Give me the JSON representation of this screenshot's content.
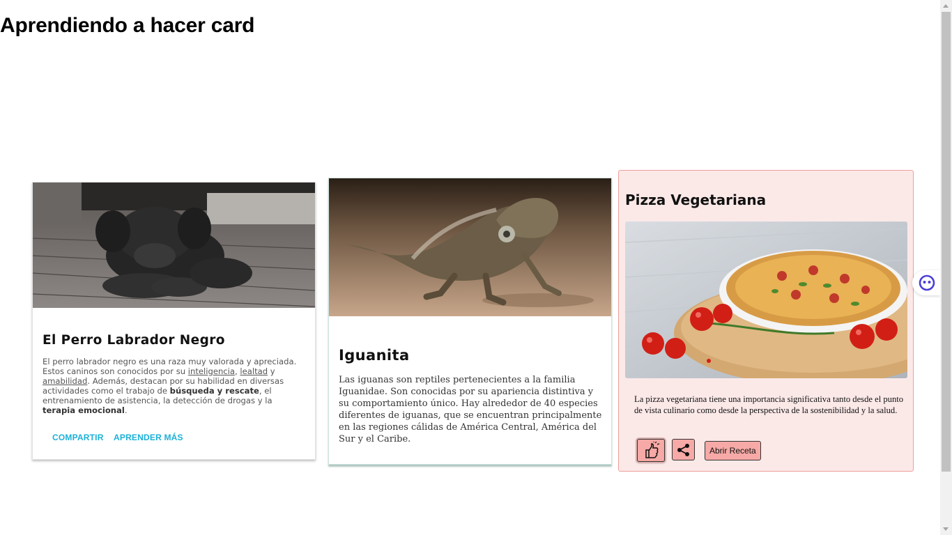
{
  "page": {
    "title": "Aprendiendo a hacer card"
  },
  "cards": {
    "dog": {
      "title": "El Perro Labrador Negro",
      "desc": {
        "p1": "El perro labrador negro es una raza muy valorada y apreciada. Estos caninos son conocidos por su ",
        "l1": "inteligencia",
        "s1": ", ",
        "l2": "lealtad",
        "s2": " y ",
        "l3": "amabilidad",
        "p2": ". Además, destacan por su habilidad en diversas actividades como el trabajo de ",
        "b1": "búsqueda y rescate",
        "p3": ", el entrenamiento de asistencia, la detección de drogas y la ",
        "b2": "terapia emocional",
        "p4": "."
      },
      "share_label": "COMPARTIR",
      "learn_label": "APRENDER MÁS"
    },
    "iguana": {
      "title": "Iguanita",
      "desc": "Las iguanas son reptiles pertenecientes a la familia Iguanidae. Son conocidas por su apariencia distintiva y su comportamiento único. Hay alrededor de 40 especies diferentes de iguanas, que se encuentran principalmente en las regiones cálidas de América Central, América del Sur y el Caribe."
    },
    "pizza": {
      "title": "Pizza Vegetariana",
      "desc": "La pizza vegetariana tiene una importancia significativa tanto desde el punto de vista culinario como desde la perspectiva de la sostenibilidad y la salud.",
      "like_icon": "thumbs-up-icon",
      "share_icon": "share-icon",
      "recipe_label": "Abrir Receta"
    }
  },
  "colors": {
    "link": "#1bb1d8",
    "pizza_card_bg": "#fbe9e8",
    "pizza_card_border": "#ec9f9c",
    "pizza_button": "#f6a9a6"
  }
}
